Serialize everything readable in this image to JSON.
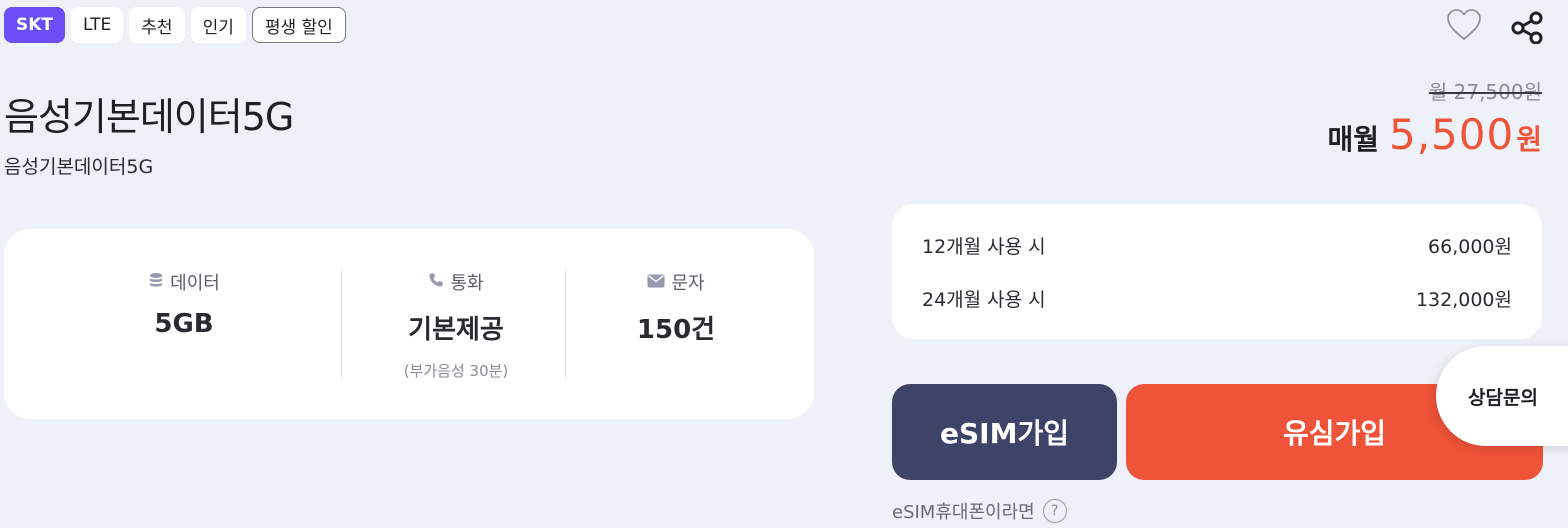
{
  "tags": [
    "SKT",
    "LTE",
    "추천",
    "인기",
    "평생 할인"
  ],
  "plan": {
    "title": "음성기본데이터5G",
    "subtitle": "음성기본데이터5G"
  },
  "price": {
    "original": "월 27,500원",
    "prefix": "매월",
    "amount": "5,500",
    "unit": "원"
  },
  "specs": {
    "data": {
      "icon": "database-icon",
      "label": "데이터",
      "value": "5GB"
    },
    "call": {
      "icon": "phone-icon",
      "label": "통화",
      "value": "기본제공",
      "note": "(부가음성 30분)"
    },
    "sms": {
      "icon": "mail-icon",
      "label": "문자",
      "value": "150건"
    }
  },
  "usage": [
    {
      "label": "12개월 사용 시",
      "value": "66,000원"
    },
    {
      "label": "24개월 사용 시",
      "value": "132,000원"
    }
  ],
  "buttons": {
    "esim": "eSIM가입",
    "usim": "유심가입",
    "consult": "상담문의"
  },
  "esim_help": "eSIM휴대폰이라면",
  "colors": {
    "background": "#eff1f9",
    "carrier_tag": "#6b4ef6",
    "accent_red": "#ef5339",
    "esim_button": "#3e4468"
  }
}
